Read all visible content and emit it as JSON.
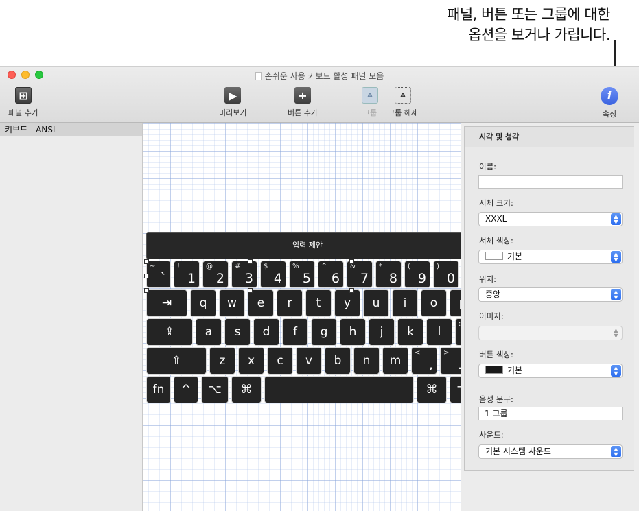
{
  "callout": {
    "line1": "패널, 버튼 또는 그룹에 대한",
    "line2": "옵션을 보거나 가립니다."
  },
  "window": {
    "title": "손쉬운 사용 키보드 활성 패널 모음"
  },
  "toolbar": {
    "add_panel": "패널 추가",
    "preview": "미리보기",
    "add_button": "버튼 추가",
    "group": "그룹",
    "ungroup": "그룹 해제",
    "properties": "속성"
  },
  "sidebar": {
    "items": [
      {
        "label": "키보드 - ANSI"
      }
    ]
  },
  "canvas": {
    "suggestion_bar": "입력 제안",
    "rows": [
      [
        {
          "s": "~",
          "m": "`"
        },
        {
          "s": "!",
          "m": "1"
        },
        {
          "s": "@",
          "m": "2"
        },
        {
          "s": "#",
          "m": "3"
        },
        {
          "s": "$",
          "m": "4"
        },
        {
          "s": "%",
          "m": "5"
        },
        {
          "s": "^",
          "m": "6"
        },
        {
          "s": "&",
          "m": "7"
        },
        {
          "s": "*",
          "m": "8"
        },
        {
          "s": "(",
          "m": "9"
        },
        {
          "s": ")",
          "m": "0"
        }
      ],
      [
        {
          "m": "⇥"
        },
        {
          "m": "q"
        },
        {
          "m": "w"
        },
        {
          "m": "e"
        },
        {
          "m": "r"
        },
        {
          "m": "t"
        },
        {
          "m": "y"
        },
        {
          "m": "u"
        },
        {
          "m": "i"
        },
        {
          "m": "o"
        },
        {
          "m": "p"
        }
      ],
      [
        {
          "m": "⇪"
        },
        {
          "m": "a"
        },
        {
          "m": "s"
        },
        {
          "m": "d"
        },
        {
          "m": "f"
        },
        {
          "m": "g"
        },
        {
          "m": "h"
        },
        {
          "m": "j"
        },
        {
          "m": "k"
        },
        {
          "m": "l"
        },
        {
          "s": ":",
          "m": ";"
        }
      ],
      [
        {
          "m": "⇧"
        },
        {
          "m": "z"
        },
        {
          "m": "x"
        },
        {
          "m": "c"
        },
        {
          "m": "v"
        },
        {
          "m": "b"
        },
        {
          "m": "n"
        },
        {
          "m": "m"
        },
        {
          "s": "<",
          "m": ","
        },
        {
          "s": ">",
          "m": "."
        }
      ],
      [
        {
          "m": "fn"
        },
        {
          "m": "^"
        },
        {
          "m": "⌥"
        },
        {
          "m": "⌘"
        },
        {
          "m": ""
        },
        {
          "m": "⌘"
        },
        {
          "m": "⌥"
        }
      ]
    ]
  },
  "inspector": {
    "section_title": "시각 및 청각",
    "name_label": "이름:",
    "name_value": "",
    "font_size_label": "서체 크기:",
    "font_size_value": "XXXL",
    "font_color_label": "서체 색상:",
    "font_color_value": "기본",
    "position_label": "위치:",
    "position_value": "중앙",
    "image_label": "이미지:",
    "image_value": "",
    "button_color_label": "버튼 색상:",
    "button_color_value": "기본",
    "speech_label": "음성 문구:",
    "speech_value": "1 그룹",
    "sound_label": "사운드:",
    "sound_value": "기본 시스템 사운드"
  },
  "colors": {
    "accent": "#2d6ef0",
    "key_bg": "#242424",
    "info_icon": "#3a63e0"
  }
}
